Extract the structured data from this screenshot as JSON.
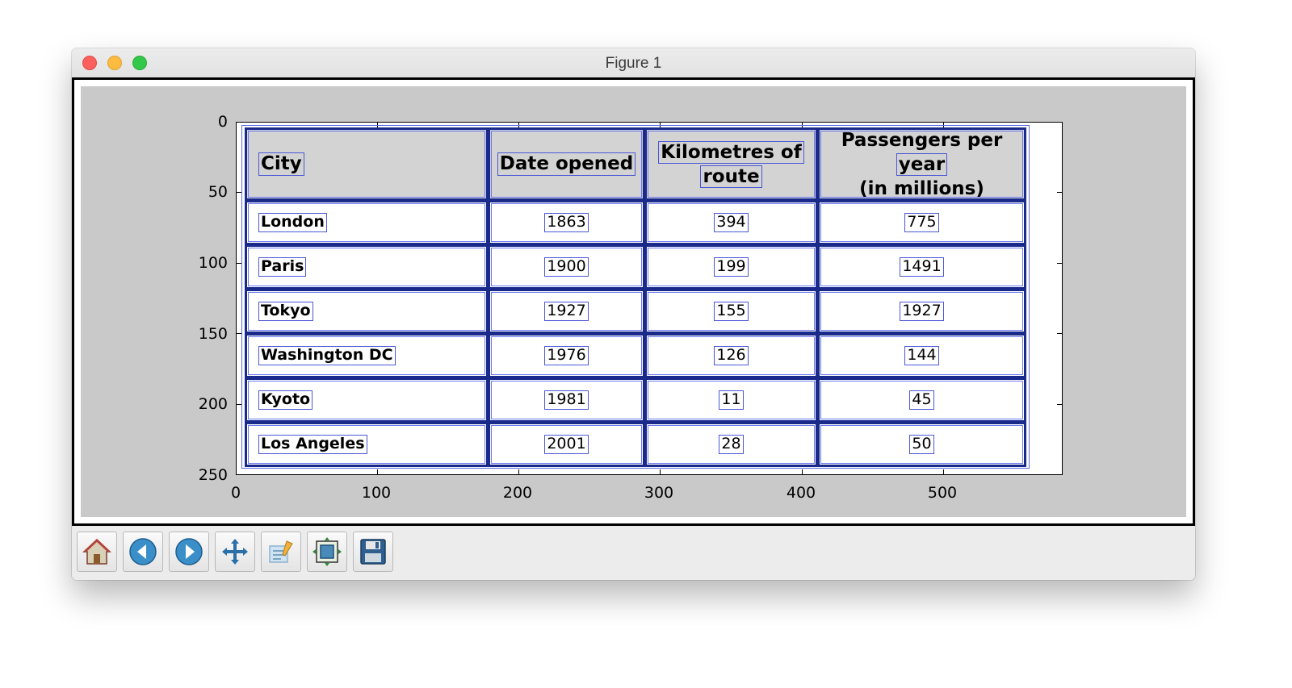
{
  "window": {
    "title": "Figure 1"
  },
  "plot": {
    "y_ticks": [
      "0",
      "50",
      "100",
      "150",
      "200",
      "250"
    ],
    "x_ticks": [
      "0",
      "100",
      "200",
      "300",
      "400",
      "500"
    ]
  },
  "table": {
    "headers": {
      "city": "City",
      "date": "Date opened",
      "km_line1": "Kilometres of",
      "km_line2": "route",
      "pass_line1": "Passengers per",
      "pass_line2": "year",
      "pass_line3": "(in  millions)"
    },
    "rows": [
      {
        "city": "London",
        "date": "1863",
        "km": "394",
        "passengers": "775"
      },
      {
        "city": "Paris",
        "date": "1900",
        "km": "199",
        "passengers": "1491"
      },
      {
        "city": "Tokyo",
        "date": "1927",
        "km": "155",
        "passengers": "1927"
      },
      {
        "city": "Washington DC",
        "date": "1976",
        "km": "126",
        "passengers": "144"
      },
      {
        "city": "Kyoto",
        "date": "1981",
        "km": "11",
        "passengers": "45"
      },
      {
        "city": "Los Angeles",
        "date": "2001",
        "km": "28",
        "passengers": "50"
      }
    ]
  },
  "toolbar": {
    "buttons": [
      "home-icon",
      "back-icon",
      "forward-icon",
      "pan-icon",
      "zoom-icon",
      "subplots-icon",
      "save-icon"
    ]
  },
  "colors": {
    "header_fill": "#d3d3d3",
    "cell_border": "#1a2a8a",
    "text_box": "#4a57d6",
    "figure_bg": "#c9c9c9"
  }
}
